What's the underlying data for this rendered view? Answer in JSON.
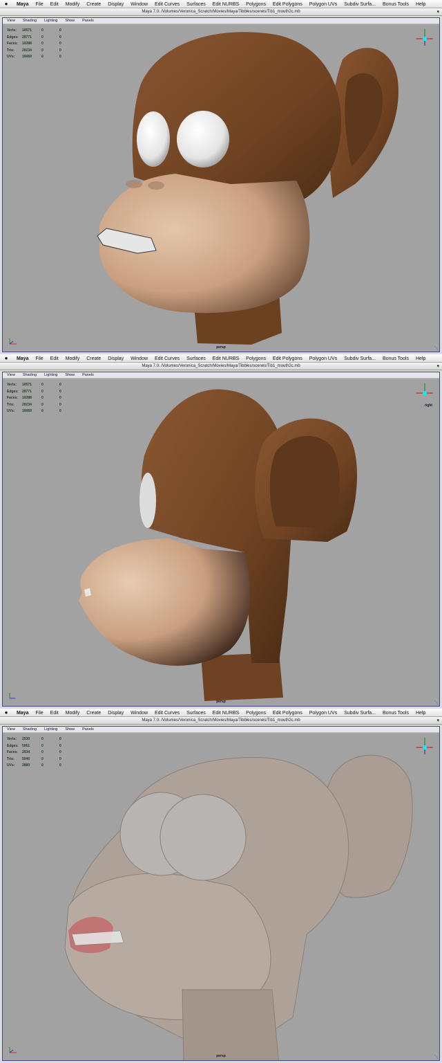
{
  "menubar": {
    "apple": "",
    "items": [
      "Maya",
      "File",
      "Edit",
      "Modify",
      "Create",
      "Display",
      "Window",
      "Edit Curves",
      "Surfaces",
      "Edit NURBS",
      "Polygons",
      "Edit Polygons",
      "Polygon UVs",
      "Subdiv Surfa...",
      "Bonus Tools",
      "Help"
    ]
  },
  "window": {
    "title": "Maya 7.0: /Volumes/Veronica_Scratch/Movies/Maya/Tibbles/scenes/Tib1_mouth2c.mb"
  },
  "viewport_menu": [
    "View",
    "Shading",
    "Lighting",
    "Show",
    "Panels"
  ],
  "panels": [
    {
      "camera": "persp",
      "view_label": "",
      "hud": [
        {
          "label": "Verts:",
          "v1": "10571",
          "v2": "0",
          "v3": "0"
        },
        {
          "label": "Edges:",
          "v1": "29771",
          "v2": "0",
          "v3": "0"
        },
        {
          "label": "Faces:",
          "v1": "10288",
          "v2": "0",
          "v3": "0"
        },
        {
          "label": "Tris:",
          "v1": "20234",
          "v2": "0",
          "v3": "0"
        },
        {
          "label": "UVs:",
          "v1": "16669",
          "v2": "0",
          "v3": "0"
        }
      ]
    },
    {
      "camera": "persp",
      "view_label": "right",
      "hud": [
        {
          "label": "Verts:",
          "v1": "10571",
          "v2": "0",
          "v3": "0"
        },
        {
          "label": "Edges:",
          "v1": "29771",
          "v2": "0",
          "v3": "0"
        },
        {
          "label": "Faces:",
          "v1": "10288",
          "v2": "0",
          "v3": "0"
        },
        {
          "label": "Tris:",
          "v1": "20234",
          "v2": "0",
          "v3": "0"
        },
        {
          "label": "UVs:",
          "v1": "16669",
          "v2": "0",
          "v3": "0"
        }
      ]
    },
    {
      "camera": "persp",
      "view_label": "",
      "hud": [
        {
          "label": "Verts:",
          "v1": "2530",
          "v2": "0",
          "v3": "0"
        },
        {
          "label": "Edges:",
          "v1": "5061",
          "v2": "0",
          "v3": "0"
        },
        {
          "label": "Faces:",
          "v1": "2534",
          "v2": "0",
          "v3": "0"
        },
        {
          "label": "Tris:",
          "v1": "5040",
          "v2": "0",
          "v3": "0"
        },
        {
          "label": "UVs:",
          "v1": "2880",
          "v2": "0",
          "v3": "0"
        }
      ]
    }
  ],
  "colors": {
    "viewport_bg": "#a2a2a2",
    "fur": "#7a4a25",
    "skin": "#d6b295",
    "hud_text": "#1d3a1d",
    "border": "#3a4b7a"
  }
}
